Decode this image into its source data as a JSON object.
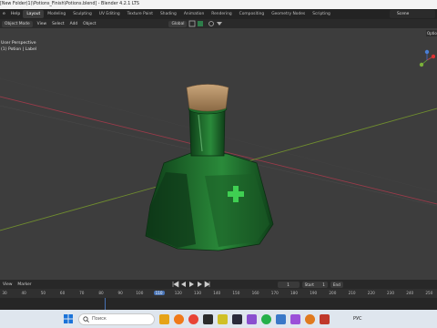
{
  "window": {
    "title": "[New Folder(1)\\Potions_Finish\\Potions.blend] - Blender 4.2.1 LTS"
  },
  "menubar": {
    "items": [
      "e",
      "Help"
    ],
    "workspace_tabs": [
      "Layout",
      "Modeling",
      "Sculpting",
      "UV Editing",
      "Texture Paint",
      "Shading",
      "Animation",
      "Rendering",
      "Compositing",
      "Geometry Nodes",
      "Scripting"
    ],
    "active_tab": "Layout",
    "scene": "Scene"
  },
  "viewport_header": {
    "mode": "Object Mode",
    "menus": [
      "View",
      "Select",
      "Add",
      "Object"
    ],
    "transform_orientation": "Global",
    "options": "Optio"
  },
  "viewport": {
    "perspective_label": "User Perspective",
    "object_label": "(1) Potion | Label"
  },
  "timeline": {
    "menus": [
      "View",
      "Marker"
    ],
    "current_frame": "1",
    "start_label": "Start",
    "start_value": "1",
    "end_label": "End",
    "ticks": [
      "30",
      "40",
      "50",
      "60",
      "70",
      "80",
      "90",
      "100",
      "110",
      "120",
      "130",
      "140",
      "150",
      "160",
      "170",
      "180",
      "190",
      "200",
      "210",
      "220",
      "230",
      "240",
      "250"
    ],
    "current_tick": "110"
  },
  "taskbar": {
    "search_placeholder": "Поиск",
    "lang": "РУС"
  },
  "colors": {
    "accent": "#4772b3",
    "bottle": "#1f6b2c",
    "cork": "#b08a5e",
    "x_axis": "#b04050",
    "y_axis": "#7a9a30"
  }
}
